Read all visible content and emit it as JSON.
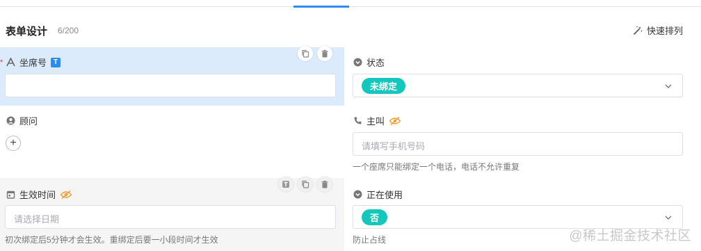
{
  "header": {
    "title": "表单设计",
    "count": "6/200",
    "quick_sort_label": "快速排列"
  },
  "fields": {
    "seat_no": {
      "label": "坐席号",
      "required_mark": "*",
      "badge": "T",
      "value": ""
    },
    "status": {
      "label": "状态",
      "value": "未绑定"
    },
    "advisor": {
      "label": "顾问",
      "add_symbol": "+"
    },
    "caller": {
      "label": "主叫",
      "placeholder": "请填写手机号码",
      "help": "一个座席只能绑定一个电话，电话不允许重复"
    },
    "effective_time": {
      "label": "生效时间",
      "placeholder": "请选择日期",
      "help": "初次绑定后5分钟才会生效。重绑定后要一小段时间才生效"
    },
    "in_use": {
      "label": "正在使用",
      "value": "否",
      "help": "防止占线"
    }
  },
  "watermark": "@稀土掘金技术社区",
  "colors": {
    "accent": "#2d8cf0",
    "pill": "#14c7bc",
    "selected_bg": "#dcebfb",
    "hidden_icon": "#f0a33a"
  }
}
